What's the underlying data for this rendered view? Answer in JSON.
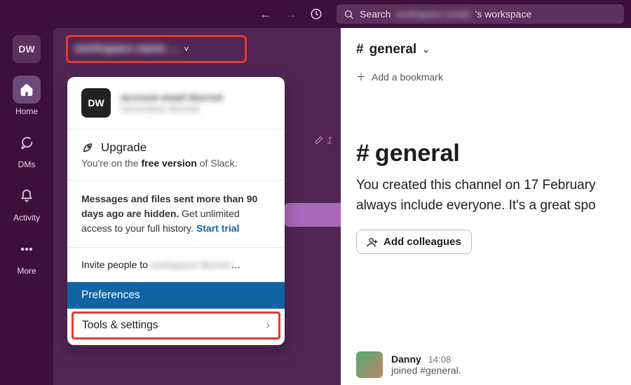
{
  "colors": {
    "brand": "#3c0f3f",
    "accent": "#e33b2e",
    "link": "#1264a3",
    "selected": "#1164a3"
  },
  "topbar": {
    "search_prefix": "Search",
    "search_blur": "workspace email",
    "search_suffix": "'s workspace"
  },
  "rail": {
    "ws_initials": "DW",
    "home": "Home",
    "dms": "DMs",
    "activity": "Activity",
    "more": "More"
  },
  "sidebar_header": {
    "workspace_blur": "workspace name …",
    "caret": "˅"
  },
  "edit_badge": "1",
  "dropdown": {
    "account_initials": "DW",
    "account_line1_blur": "account email blurred",
    "account_line2_blur": "secondary blurred",
    "upgrade_title": "Upgrade",
    "upgrade_sub_pre": "You're on the ",
    "upgrade_sub_bold": "free version",
    "upgrade_sub_post": " of Slack.",
    "history_bold": "Messages and files sent more than 90 days ago are hidden.",
    "history_rest": " Get unlimited access to your full history. ",
    "history_link": "Start trial",
    "invite_prefix": "Invite people to ",
    "invite_blur": "workspace blurred",
    "invite_ellipsis": "…",
    "preferences": "Preferences",
    "tools": "Tools & settings"
  },
  "content": {
    "channel_prefix": "#",
    "channel_name": "general",
    "bookmark": "Add a bookmark",
    "hero_text": "You created this channel on 17 February always include everyone. It's a great spo",
    "add_colleagues": "Add colleagues",
    "msg_name": "Danny",
    "msg_time": "14:08",
    "msg_body": "joined #general."
  }
}
